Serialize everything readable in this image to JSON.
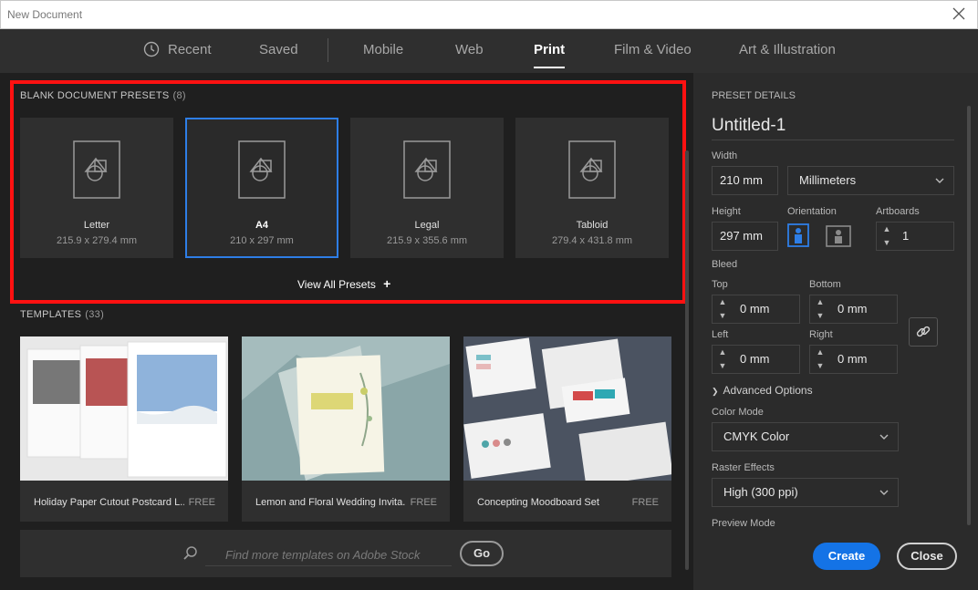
{
  "window": {
    "title": "New Document"
  },
  "tabs": [
    "Recent",
    "Saved",
    "Mobile",
    "Web",
    "Print",
    "Film & Video",
    "Art & Illustration"
  ],
  "active_tab": "Print",
  "presets_section": {
    "title": "BLANK DOCUMENT PRESETS",
    "count": "(8)"
  },
  "presets": [
    {
      "name": "Letter",
      "size": "215.9 x 279.4 mm"
    },
    {
      "name": "A4",
      "size": "210 x 297 mm"
    },
    {
      "name": "Legal",
      "size": "215.9 x 355.6 mm"
    },
    {
      "name": "Tabloid",
      "size": "279.4 x 431.8 mm"
    }
  ],
  "selected_preset": "A4",
  "view_all": "View All Presets",
  "templates_section": {
    "title": "TEMPLATES",
    "count": "(33)"
  },
  "templates": [
    {
      "name": "Holiday Paper Cutout Postcard L...",
      "badge": "FREE"
    },
    {
      "name": "Lemon and Floral Wedding Invita...",
      "badge": "FREE"
    },
    {
      "name": "Concepting Moodboard Set",
      "badge": "FREE"
    }
  ],
  "search": {
    "placeholder": "Find more templates on Adobe Stock",
    "go_label": "Go"
  },
  "details": {
    "header": "PRESET DETAILS",
    "doc_name": "Untitled-1",
    "width_label": "Width",
    "width_value": "210 mm",
    "units": "Millimeters",
    "height_label": "Height",
    "height_value": "297 mm",
    "orientation_label": "Orientation",
    "artboards_label": "Artboards",
    "artboards_value": "1",
    "bleed_label": "Bleed",
    "top_label": "Top",
    "top_value": "0 mm",
    "bottom_label": "Bottom",
    "bottom_value": "0 mm",
    "left_label": "Left",
    "left_value": "0 mm",
    "right_label": "Right",
    "right_value": "0 mm",
    "advanced_label": "Advanced Options",
    "color_mode_label": "Color Mode",
    "color_mode_value": "CMYK Color",
    "raster_label": "Raster Effects",
    "raster_value": "High (300 ppi)",
    "preview_label": "Preview Mode"
  },
  "buttons": {
    "create": "Create",
    "close": "Close"
  },
  "colors": {
    "accent": "#1473e6",
    "highlight": "#ff1111",
    "selection": "#2e7ee6"
  }
}
